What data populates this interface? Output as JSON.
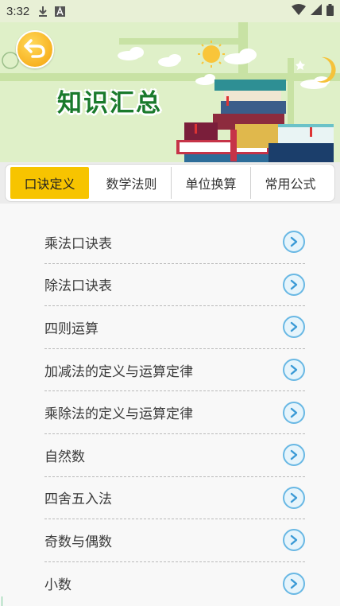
{
  "status_bar": {
    "time": "3:32",
    "left_icons": [
      "download-icon",
      "font-a-icon"
    ],
    "right_icons": [
      "wifi-icon",
      "signal-icon",
      "battery-icon"
    ]
  },
  "header": {
    "title": "知识汇总",
    "back_icon": "back-arrow-icon"
  },
  "tabs": [
    {
      "label": "口诀定义",
      "active": true
    },
    {
      "label": "数学法则",
      "active": false
    },
    {
      "label": "单位换算",
      "active": false
    },
    {
      "label": "常用公式",
      "active": false
    }
  ],
  "list": {
    "items": [
      {
        "label": "乘法口诀表"
      },
      {
        "label": "除法口诀表"
      },
      {
        "label": "四则运算"
      },
      {
        "label": "加减法的定义与运算定律"
      },
      {
        "label": "乘除法的定义与运算定律"
      },
      {
        "label": "自然数"
      },
      {
        "label": "四舍五入法"
      },
      {
        "label": "奇数与偶数"
      },
      {
        "label": "小数"
      }
    ],
    "item_icon": "chevron-right-icon"
  },
  "colors": {
    "banner_bg": "#dff0c8",
    "title_green": "#1a7a2c",
    "active_tab": "#f7c400",
    "arrow_blue": "#69b8e4"
  }
}
